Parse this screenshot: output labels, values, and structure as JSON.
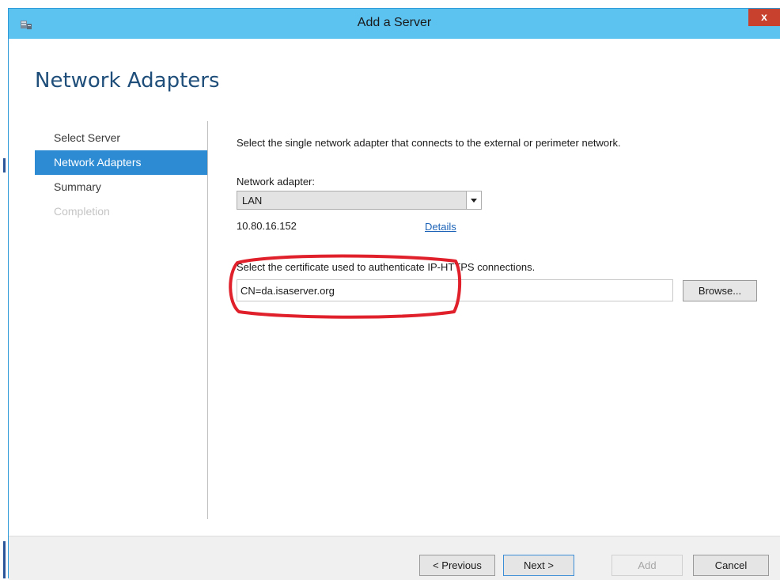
{
  "window": {
    "title": "Add a Server",
    "close_label": "x"
  },
  "page": {
    "title": "Network Adapters"
  },
  "nav": {
    "items": [
      {
        "label": "Select Server",
        "state": "normal"
      },
      {
        "label": "Network Adapters",
        "state": "active"
      },
      {
        "label": "Summary",
        "state": "normal"
      },
      {
        "label": "Completion",
        "state": "disabled"
      }
    ]
  },
  "content": {
    "instruction": "Select the single network adapter that connects to the external or perimeter network.",
    "adapter_label": "Network adapter:",
    "adapter_value": "LAN",
    "ip_address": "10.80.16.152",
    "details_link": "Details",
    "cert_label": "Select the certificate used to authenticate IP-HTTPS connections.",
    "cert_value": "CN=da.isaserver.org",
    "browse_label": "Browse..."
  },
  "footer": {
    "previous_label": "< Previous",
    "next_label": "Next >",
    "add_label": "Add",
    "cancel_label": "Cancel"
  },
  "colors": {
    "titlebar": "#5cc2f0",
    "close": "#c7412e",
    "nav_active": "#2d8bd4",
    "page_title": "#1e4e79",
    "link": "#1c63b7",
    "annotation": "#e0202a"
  }
}
